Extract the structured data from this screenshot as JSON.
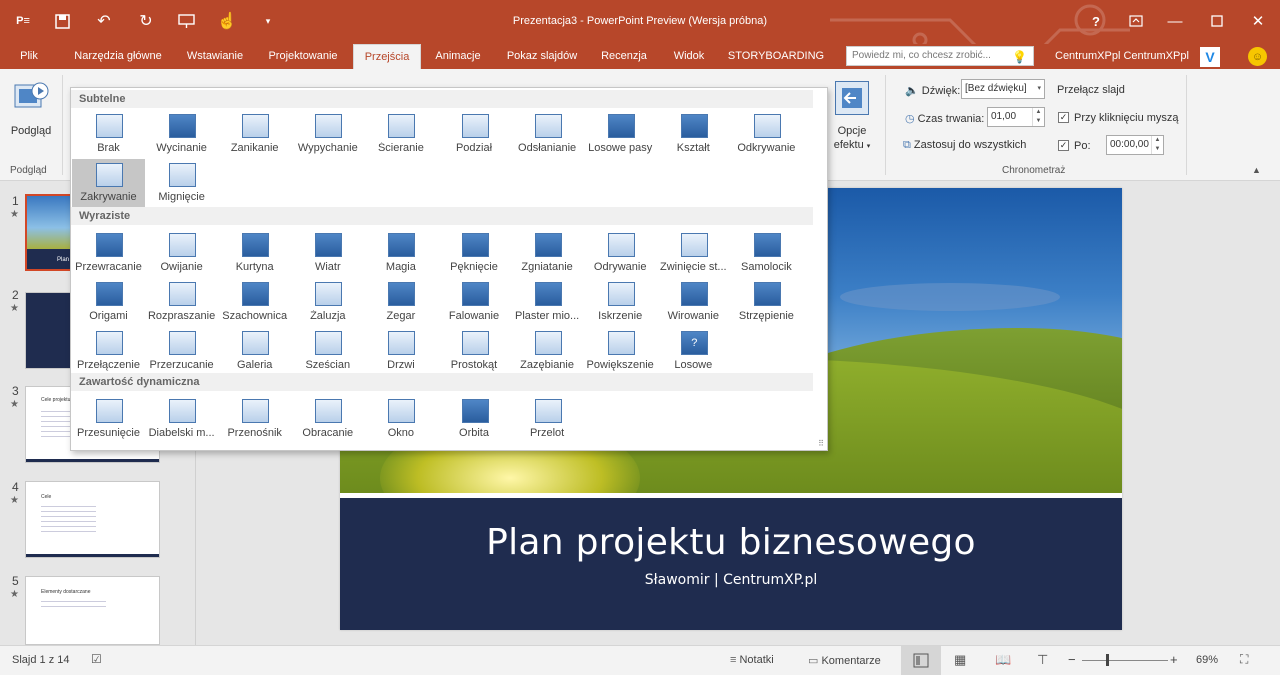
{
  "titlebar": {
    "title": "Prezentacja3 - PowerPoint Preview (Wersja próbna)",
    "qa": [
      "ppt-logo-icon",
      "save-icon",
      "undo-icon",
      "redo-icon",
      "present-icon",
      "touch-mode-icon",
      "customize-icon"
    ],
    "window": [
      "help-icon",
      "ribbon-display-icon",
      "minimize-icon",
      "maximize-icon",
      "close-icon"
    ],
    "help_glyph": "?",
    "accent": "#b7472a"
  },
  "tabs": [
    {
      "label": "Plik",
      "active": false
    },
    {
      "label": "Narzędzia główne",
      "active": false
    },
    {
      "label": "Wstawianie",
      "active": false
    },
    {
      "label": "Projektowanie",
      "active": false
    },
    {
      "label": "Przejścia",
      "active": true
    },
    {
      "label": "Animacje",
      "active": false
    },
    {
      "label": "Pokaz slajdów",
      "active": false
    },
    {
      "label": "Recenzja",
      "active": false
    },
    {
      "label": "Widok",
      "active": false
    },
    {
      "label": "STORYBOARDING",
      "active": false
    }
  ],
  "tellme": {
    "placeholder": "Powiedz mi, co chcesz zrobić..."
  },
  "user": {
    "name": "CentrumXPpl CentrumXPpl"
  },
  "ribbon": {
    "preview": {
      "label": "Podgląd",
      "group": "Podgląd"
    },
    "effect_options": {
      "line1": "Opcje",
      "line2": "efektu"
    },
    "timing": {
      "sound_label": "Dźwięk:",
      "sound_value": "[Bez dźwięku]",
      "duration_label": "Czas trwania:",
      "duration_value": "01,00",
      "apply_all": "Zastosuj do wszystkich",
      "advance_title": "Przełącz slajd",
      "on_click": "Przy kliknięciu myszą",
      "on_click_checked": true,
      "after_label": "Po:",
      "after_checked": true,
      "after_value": "00:00,00",
      "group": "Chronometraż"
    }
  },
  "gallery": {
    "sections": [
      {
        "title": "Subtelne",
        "items": [
          "Brak",
          "Wycinanie",
          "Zanikanie",
          "Wypychanie",
          "Ścieranie",
          "Podział",
          "Odsłanianie",
          "Losowe pasy",
          "Kształt",
          "Odkrywanie",
          "Zakrywanie",
          "Mignięcie"
        ]
      },
      {
        "title": "Wyraziste",
        "items": [
          "Przewracanie",
          "Owijanie",
          "Kurtyna",
          "Wiatr",
          "Magia",
          "Pęknięcie",
          "Zgniatanie",
          "Odrywanie",
          "Zwinięcie st...",
          "Samolocik",
          "Origami",
          "Rozpraszanie",
          "Szachownica",
          "Żaluzja",
          "Zegar",
          "Falowanie",
          "Plaster mio...",
          "Iskrzenie",
          "Wirowanie",
          "Strzępienie",
          "Przełączenie",
          "Przerzucanie",
          "Galeria",
          "Sześcian",
          "Drzwi",
          "Prostokąt",
          "Zazębianie",
          "Powiększenie",
          "Losowe"
        ]
      },
      {
        "title": "Zawartość dynamiczna",
        "items": [
          "Przesunięcie",
          "Diabelski m...",
          "Przenośnik",
          "Obracanie",
          "Okno",
          "Orbita",
          "Przelot"
        ]
      }
    ],
    "selected": "Zakrywanie",
    "random_glyph": "?"
  },
  "thumbnails": [
    {
      "num": "1",
      "star": "★",
      "selected": true,
      "text": "Plan"
    },
    {
      "num": "2",
      "star": "★",
      "selected": false,
      "text": ""
    },
    {
      "num": "3",
      "star": "★",
      "selected": false,
      "text": "Cele projektu"
    },
    {
      "num": "4",
      "star": "★",
      "selected": false,
      "text": "Cele"
    },
    {
      "num": "5",
      "star": "★",
      "selected": false,
      "text": "Elementy dostarczane"
    }
  ],
  "slide": {
    "title": "Plan projektu biznesowego",
    "subtitle": "Sławomir | CentrumXP.pl"
  },
  "status": {
    "slide_info": "Slajd 1 z 14",
    "notes": "Notatki",
    "comments": "Komentarze",
    "zoom_out": "−",
    "zoom_in": "+",
    "zoom": "69%"
  }
}
